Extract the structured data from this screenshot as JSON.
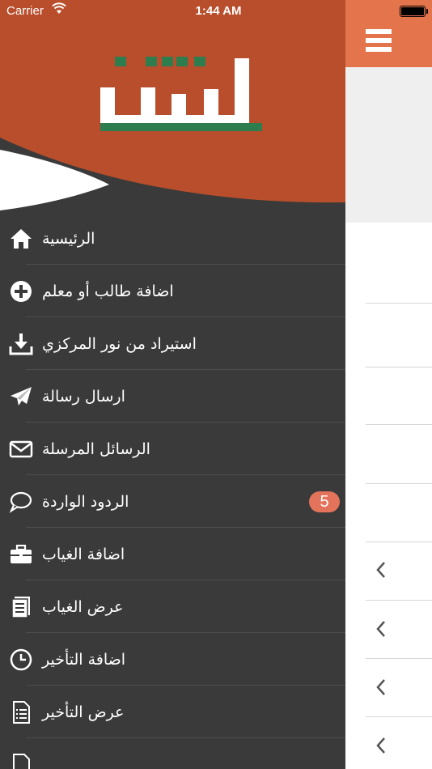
{
  "status_bar": {
    "carrier": "Carrier",
    "time": "1:44 AM"
  },
  "brand": {
    "logo_text": "اتقان",
    "header_color": "#b84e2b",
    "accent": "#e4744c",
    "logo_green": "#2e7d4f"
  },
  "menu": {
    "items": [
      {
        "label": "الرئيسية",
        "icon": "home-icon"
      },
      {
        "label": "اضافة طالب أو معلم",
        "icon": "plus-circle-icon"
      },
      {
        "label": "استيراد من نور المركزي",
        "icon": "download-icon"
      },
      {
        "label": "ارسال رسالة",
        "icon": "paper-plane-icon"
      },
      {
        "label": "الرسائل المرسلة",
        "icon": "envelope-icon"
      },
      {
        "label": "الردود الواردة",
        "icon": "chat-bubble-icon",
        "badge": "5"
      },
      {
        "label": "اضافة الغياب",
        "icon": "briefcase-icon"
      },
      {
        "label": "عرض الغياب",
        "icon": "document-icon"
      },
      {
        "label": "اضافة التأخير",
        "icon": "clock-icon"
      },
      {
        "label": "عرض التأخير",
        "icon": "list-document-icon"
      }
    ]
  }
}
